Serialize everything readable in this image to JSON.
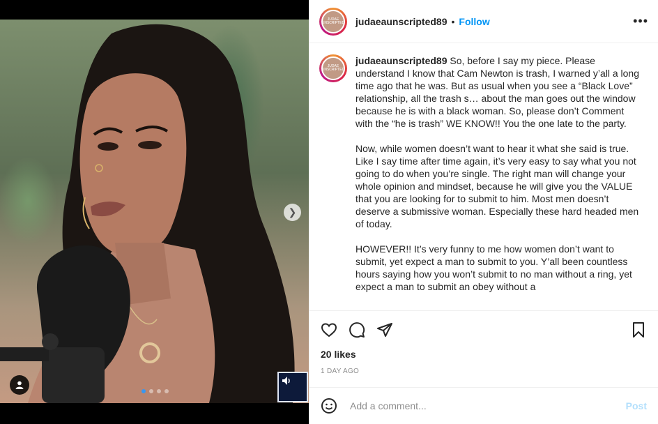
{
  "post": {
    "username": "judaeaunscripted89",
    "separator": "•",
    "follow_label": "Follow",
    "more_icon": "more-horizontal-icon",
    "avatar_text": "JUDAE UNSCRIPTED",
    "caption": {
      "username": "judaeaunscripted89",
      "paragraphs": [
        "So, before I say my piece. Please understand I know that Cam Newton is trash, I warned y’all a long time ago that he was. But as usual when you see a “Black Love” relationship, all the trash s… about the man goes out the window because he is with a black woman. So, please don’t Comment with the “he is trash” WE KNOW!! You the one late to the party.",
        "Now, while women doesn’t want to hear it what she said is true. Like I say time after time again, it’s very easy to say what you not going to do when you’re single. The right man will change your whole opinion and mindset, because he will give you the VALUE that you are looking for to submit to him. Most men doesn’t deserve a submissive woman. Especially these hard headed men of today.",
        "HOWEVER!! It’s very funny to me how women don’t want to submit, yet expect a man to submit to you. Y’all been countless hours saying how you won’t submit to no man without a ring, yet expect a man to submit an obey without a"
      ]
    },
    "likes": "20 likes",
    "timestamp": "1 DAY AGO",
    "comment_placeholder": "Add a comment...",
    "post_label": "Post"
  },
  "media": {
    "carousel_count": 4,
    "carousel_active": 0,
    "next_icon": "chevron-right-icon",
    "tag_icon": "user-tag-icon",
    "sound_icon": "speaker-icon"
  },
  "colors": {
    "follow": "#0095f6",
    "post_disabled": "#b2dffc",
    "carousel_active": "#3897f0",
    "muted_text": "#8e8e8e"
  }
}
